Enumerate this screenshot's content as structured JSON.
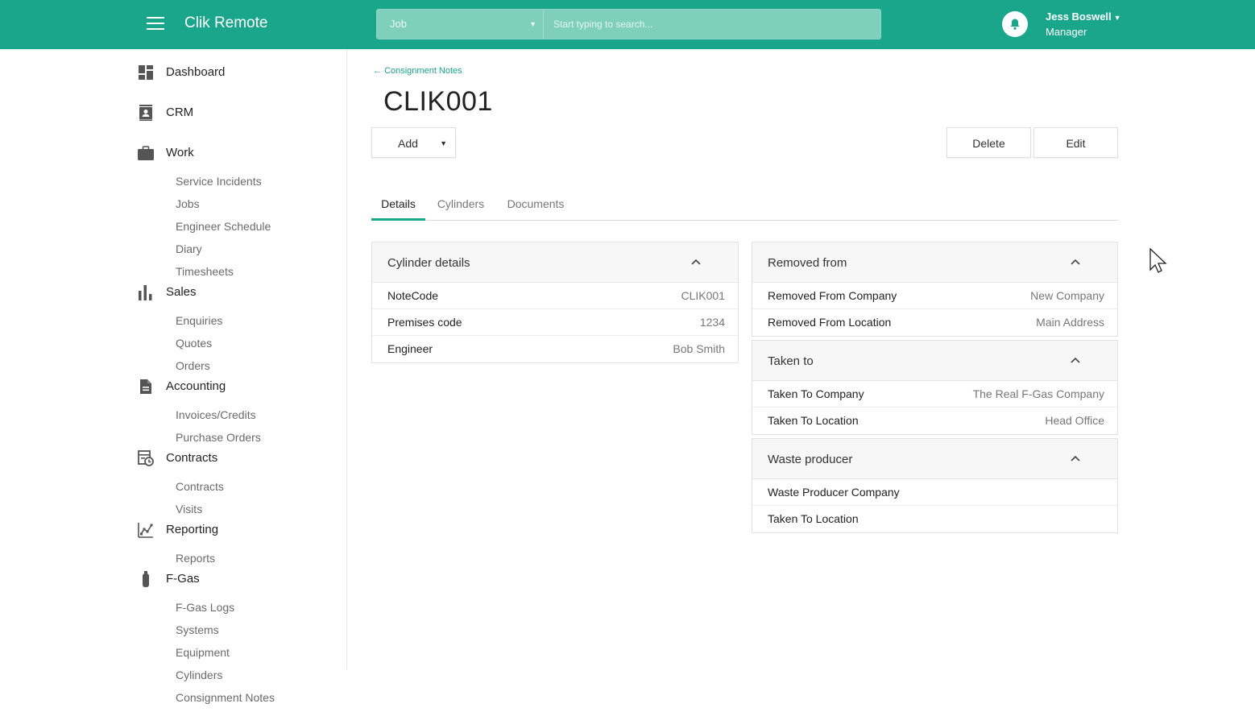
{
  "app": {
    "title": "Clik Remote"
  },
  "search": {
    "type_selected": "Job",
    "placeholder": "Start typing to search..."
  },
  "user": {
    "name": "Jess Boswell",
    "role": "Manager"
  },
  "sidebar": {
    "dashboard": "Dashboard",
    "crm": "CRM",
    "work": {
      "label": "Work",
      "items": [
        "Service Incidents",
        "Jobs",
        "Engineer Schedule",
        "Diary",
        "Timesheets"
      ]
    },
    "sales": {
      "label": "Sales",
      "items": [
        "Enquiries",
        "Quotes",
        "Orders"
      ]
    },
    "accounting": {
      "label": "Accounting",
      "items": [
        "Invoices/Credits",
        "Purchase Orders"
      ]
    },
    "contracts": {
      "label": "Contracts",
      "items": [
        "Contracts",
        "Visits"
      ]
    },
    "reporting": {
      "label": "Reporting",
      "items": [
        "Reports"
      ]
    },
    "fgas": {
      "label": "F-Gas",
      "items": [
        "F-Gas Logs",
        "Systems",
        "Equipment",
        "Cylinders",
        "Consignment Notes"
      ]
    }
  },
  "page": {
    "back_label": "Consignment Notes",
    "title": "CLIK001",
    "add_label": "Add",
    "delete_label": "Delete",
    "edit_label": "Edit",
    "tabs": [
      "Details",
      "Cylinders",
      "Documents"
    ]
  },
  "cylinder_details": {
    "title": "Cylinder details",
    "rows": [
      {
        "label": "NoteCode",
        "value": "CLIK001"
      },
      {
        "label": "Premises code",
        "value": "1234"
      },
      {
        "label": "Engineer",
        "value": "Bob Smith"
      }
    ]
  },
  "removed_from": {
    "title": "Removed from",
    "rows": [
      {
        "label": "Removed From Company",
        "value": "New Company"
      },
      {
        "label": "Removed From Location",
        "value": "Main Address"
      }
    ]
  },
  "taken_to": {
    "title": "Taken to",
    "rows": [
      {
        "label": "Taken To Company",
        "value": "The Real F-Gas Company"
      },
      {
        "label": "Taken To Location",
        "value": "Head Office"
      }
    ]
  },
  "waste_producer": {
    "title": "Waste producer",
    "rows": [
      {
        "label": "Waste Producer Company",
        "value": ""
      },
      {
        "label": "Taken To Location",
        "value": ""
      }
    ]
  },
  "icons": [
    "menu-icon",
    "bell-icon",
    "dashboard-icon",
    "crm-icon",
    "briefcase-icon",
    "bar-chart-icon",
    "document-icon",
    "contracts-icon",
    "reporting-icon",
    "cylinder-icon",
    "chevron-up-icon",
    "arrow-left-icon",
    "caret-down-icon"
  ],
  "colors": {
    "brand": "#1aa68b",
    "search_bg": "#7fcfbd"
  }
}
